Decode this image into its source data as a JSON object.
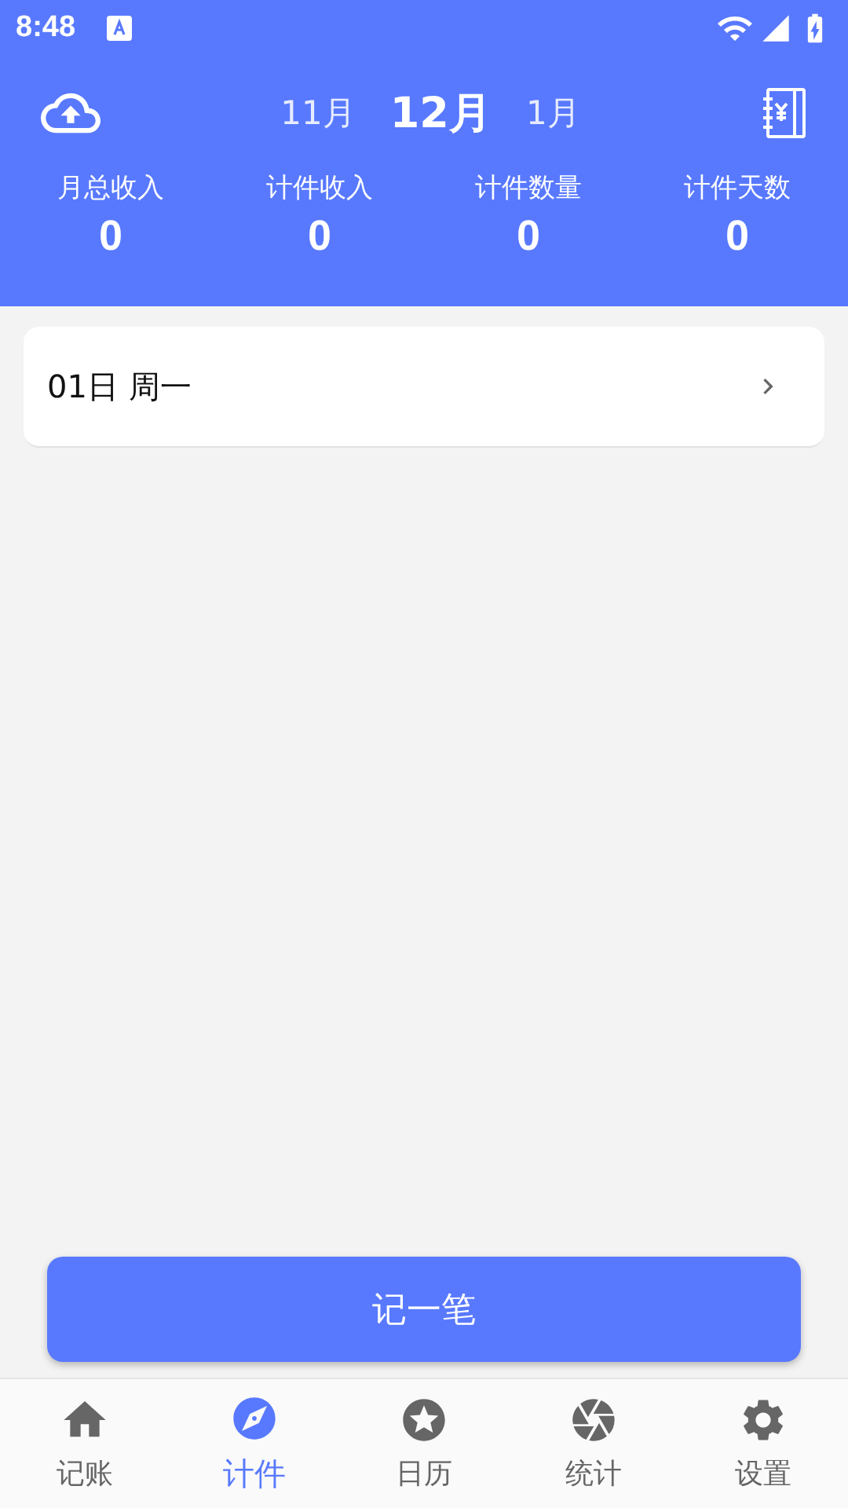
{
  "status_bar": {
    "time": "8:48"
  },
  "header": {
    "months": [
      {
        "label": "11月",
        "selected": false
      },
      {
        "label": "12月",
        "selected": true
      },
      {
        "label": "1月",
        "selected": false
      }
    ]
  },
  "stats": [
    {
      "label": "月总收入",
      "value": "0"
    },
    {
      "label": "计件收入",
      "value": "0"
    },
    {
      "label": "计件数量",
      "value": "0"
    },
    {
      "label": "计件天数",
      "value": "0"
    }
  ],
  "days": [
    {
      "label": "01日 周一"
    }
  ],
  "record_button": "记一笔",
  "tabs": [
    {
      "kind": "home",
      "label": "记账",
      "selected": false
    },
    {
      "kind": "compass",
      "label": "计件",
      "selected": true
    },
    {
      "kind": "star",
      "label": "日历",
      "selected": false
    },
    {
      "kind": "aperture",
      "label": "统计",
      "selected": false
    },
    {
      "kind": "gear",
      "label": "设置",
      "selected": false
    }
  ]
}
